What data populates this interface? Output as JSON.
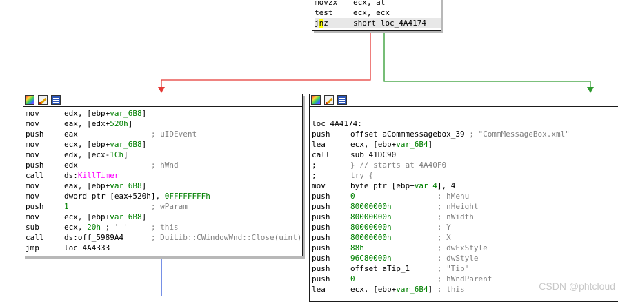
{
  "colors": {
    "edge_false": "#e53935",
    "edge_true": "#2e9a2e",
    "edge_flow": "#2d55d8",
    "variable": "#008000",
    "import": "#ff00ff",
    "comment": "#808080"
  },
  "top_block": {
    "lines": [
      {
        "mn": "movzx",
        "op": "ecx, al",
        "cm": ""
      },
      {
        "mn": "test",
        "op": "ecx, ecx",
        "cm": ""
      },
      {
        "mn_pre": "j",
        "mn_hl": "n",
        "mn_post": "z",
        "op": "short loc_4A4174",
        "cm": ""
      }
    ]
  },
  "left_block": {
    "toolbar_icons": [
      "graph-overview-icon",
      "edit-icon",
      "list-icon"
    ],
    "lines": [
      {
        "mn": "mov",
        "op_pre": "edx, [ebp+",
        "var": "var_6B8",
        "op_post": "]",
        "cm": ""
      },
      {
        "mn": "mov",
        "op_pre": "eax, [edx+",
        "var": "520h",
        "op_post": "]",
        "cm": ""
      },
      {
        "mn": "push",
        "op_pre": "eax",
        "var": "",
        "op_post": "",
        "cm": "; uIDEvent"
      },
      {
        "mn": "mov",
        "op_pre": "ecx, [ebp+",
        "var": "var_6B8",
        "op_post": "]",
        "cm": ""
      },
      {
        "mn": "mov",
        "op_pre": "edx, [ecx-",
        "var": "1Ch",
        "op_post": "]",
        "cm": ""
      },
      {
        "mn": "push",
        "op_pre": "edx",
        "var": "",
        "op_post": "",
        "cm": "; hWnd"
      },
      {
        "mn": "call",
        "op_pre": "ds:",
        "fn": "KillTimer",
        "op_post": "",
        "cm": ""
      },
      {
        "mn": "mov",
        "op_pre": "eax, [ebp+",
        "var": "var_6B8",
        "op_post": "]",
        "cm": ""
      },
      {
        "mn": "mov",
        "op_pre": "dword ptr [eax+520h], ",
        "var": "0FFFFFFFFh",
        "op_post": "",
        "cm": ""
      },
      {
        "mn": "push",
        "op_pre": "",
        "var": "1",
        "op_post": "",
        "cm": "; wParam"
      },
      {
        "mn": "mov",
        "op_pre": "ecx, [ebp+",
        "var": "var_6B8",
        "op_post": "]",
        "cm": ""
      },
      {
        "mn": "sub",
        "op_pre": "ecx, ",
        "var": "20h",
        "op_post": " ; ' '",
        "cm": "; this"
      },
      {
        "mn": "call",
        "op_pre": "ds:off_5989A4",
        "var": "",
        "op_post": "",
        "cm": "; DuiLib::CWindowWnd::Close(uint)"
      },
      {
        "mn": "jmp",
        "op_pre": "loc_4A4333",
        "var": "",
        "op_post": "",
        "cm": ""
      }
    ]
  },
  "right_block": {
    "toolbar_icons": [
      "graph-overview-icon",
      "edit-icon",
      "list-icon"
    ],
    "label": "loc_4A4174:",
    "lines": [
      {
        "mn": "push",
        "op_pre": "offset aCommmessagebox_39",
        "var": "",
        "op_post": "",
        "cm": "; \"CommMessageBox.xml\""
      },
      {
        "mn": "lea",
        "op_pre": "ecx, [ebp+",
        "var": "var_6B4",
        "op_post": "]",
        "cm": ""
      },
      {
        "mn": "call",
        "op_pre": "sub_41DC90",
        "var": "",
        "op_post": "",
        "cm": ""
      },
      {
        "mn": ";",
        "op_pre": "",
        "var": "",
        "op_post": "",
        "cm": "} // starts at 4A40F0"
      },
      {
        "mn": ";",
        "op_pre": "",
        "var": "",
        "op_post": "",
        "cm": "try {"
      },
      {
        "mn": "mov",
        "op_pre": "byte ptr [ebp+",
        "var": "var_4",
        "op_post": "], 4",
        "cm": ""
      },
      {
        "mn": "push",
        "op_pre": "",
        "var": "0",
        "op_post": "",
        "cm": "; hMenu"
      },
      {
        "mn": "push",
        "op_pre": "",
        "var": "80000000h",
        "op_post": "",
        "cm": "; nHeight"
      },
      {
        "mn": "push",
        "op_pre": "",
        "var": "80000000h",
        "op_post": "",
        "cm": "; nWidth"
      },
      {
        "mn": "push",
        "op_pre": "",
        "var": "80000000h",
        "op_post": "",
        "cm": "; Y"
      },
      {
        "mn": "push",
        "op_pre": "",
        "var": "80000000h",
        "op_post": "",
        "cm": "; X"
      },
      {
        "mn": "push",
        "op_pre": "",
        "var": "88h",
        "op_post": "",
        "cm": "; dwExStyle"
      },
      {
        "mn": "push",
        "op_pre": "",
        "var": "96C80000h",
        "op_post": "",
        "cm": "; dwStyle"
      },
      {
        "mn": "push",
        "op_pre": "offset aTip_1",
        "var": "",
        "op_post": "",
        "cm": "; \"Tip\""
      },
      {
        "mn": "push",
        "op_pre": "",
        "var": "0",
        "op_post": "",
        "cm": "; hWndParent"
      },
      {
        "mn": "lea",
        "op_pre": "ecx, [ebp+",
        "var": "var_6B4",
        "op_post": "]",
        "cm": "; this"
      }
    ]
  },
  "watermark": "CSDN @phtcloud"
}
